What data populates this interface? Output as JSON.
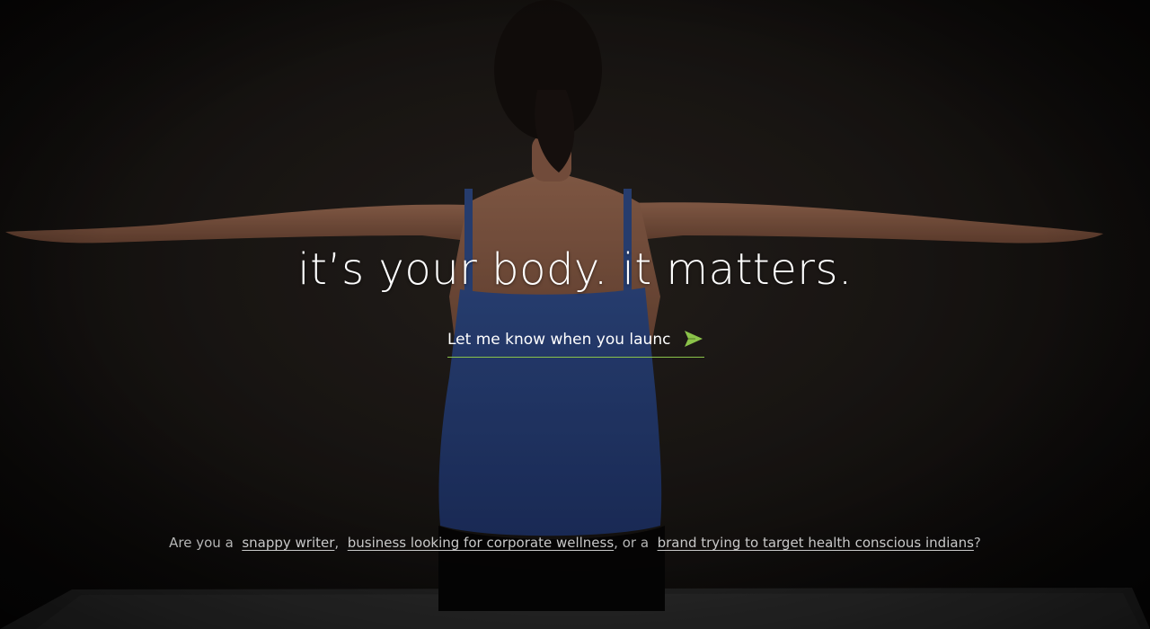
{
  "hero": {
    "headline": "it’s your body. it matters."
  },
  "signup": {
    "placeholder": "Let me know when you launch",
    "submit_icon": "send-arrow-icon",
    "accent_color": "#8bc34a"
  },
  "tagline": {
    "prefix": "Are you a",
    "link_1": "snappy writer",
    "sep_1": ",",
    "link_2": "business looking for corporate wellness",
    "sep_2": ",  or a",
    "link_3": "brand trying to target health conscious indians",
    "suffix": "?"
  }
}
